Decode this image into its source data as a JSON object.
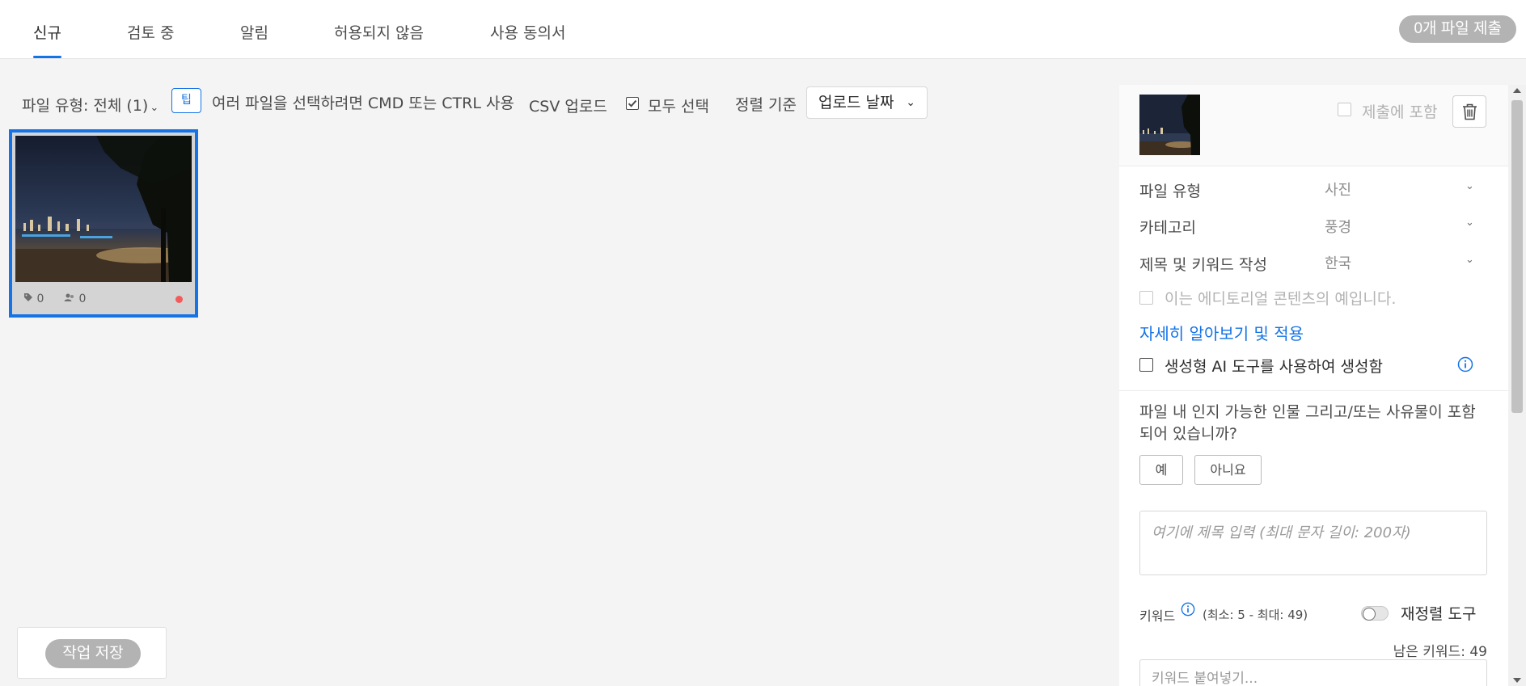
{
  "nav": {
    "tabs": [
      {
        "label": "신규",
        "active": true
      },
      {
        "label": "검토 중"
      },
      {
        "label": "알림"
      },
      {
        "label": "허용되지 않음"
      },
      {
        "label": "사용 동의서"
      }
    ],
    "submit_label": "0개 파일 제출"
  },
  "toolbar": {
    "filetype_label": "파일 유형: 전체 (1)",
    "tip_badge": "팁",
    "tip_text": "여러 파일을 선택하려면 CMD 또는 CTRL 사용",
    "csv_label": "CSV 업로드",
    "select_all_label": "모두 선택",
    "select_all_checked": true,
    "sort_by_label": "정렬 기준",
    "sort_value": "업로드 날짜"
  },
  "card": {
    "keyword_count": "0",
    "people_count": "0",
    "status_color": "#f35a5a"
  },
  "save_label": "작업 저장",
  "panel": {
    "include_label": "제출에 포함",
    "fields": [
      {
        "label": "파일 유형",
        "value": "사진"
      },
      {
        "label": "카테고리",
        "value": "풍경"
      },
      {
        "label": "제목 및 키워드 작성",
        "value": "한국"
      }
    ],
    "editorial_label": "이는 에디토리얼 콘텐츠의 예입니다.",
    "learn_link": "자세히 알아보기 및 적용",
    "genai_label": "생성형 AI 도구를 사용하여 생성함",
    "question": "파일 내 인지 가능한 인물 그리고/또는 사유물이 포함되어 있습니까?",
    "yes_label": "예",
    "no_label": "아니요",
    "title_placeholder": "여기에 제목 입력 (최대 문자 길이: 200자)",
    "keywords_label": "키워드",
    "keywords_range": "(최소: 5 - 최대: 49)",
    "reorder_label": "재정렬 도구",
    "remaining_label": "남은 키워드: 49",
    "keywords_placeholder": "키워드 붙여넣기..."
  },
  "colors": {
    "accent": "#1473e6",
    "disabled_button": "#b3b3b3"
  }
}
